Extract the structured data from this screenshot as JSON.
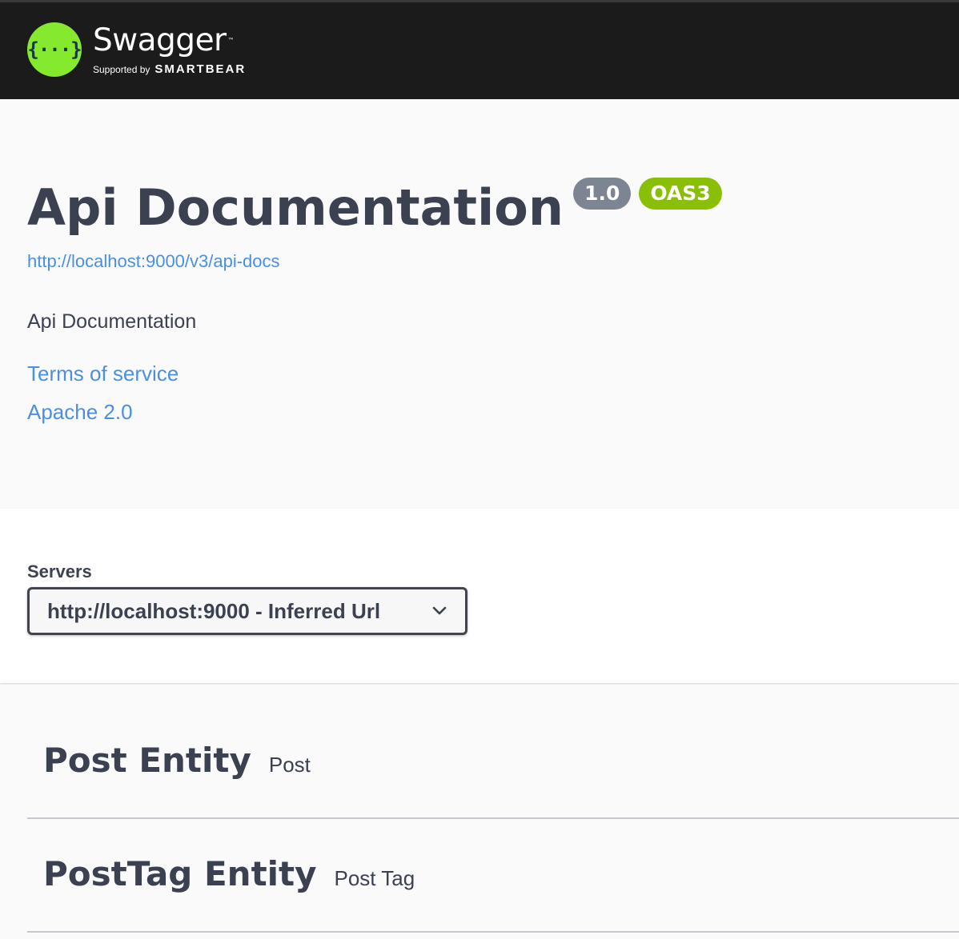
{
  "topbar": {
    "brand_name": "Swagger",
    "brand_tm": "™",
    "logo_glyph": "{···}",
    "supported_by": "Supported by",
    "sponsor": "SMARTBEAR",
    "logo_color": "#85ea2d",
    "background_color": "#1b1b1b"
  },
  "info": {
    "title": "Api Documentation",
    "version_badge": "1.0",
    "oas_badge": "OAS3",
    "spec_url": "http://localhost:9000/v3/api-docs",
    "description": "Api Documentation",
    "terms_link": "Terms of service",
    "license_link": "Apache 2.0",
    "version_badge_color": "#7d8492",
    "oas_badge_color": "#89bf04",
    "link_color": "#4990e2"
  },
  "servers": {
    "label": "Servers",
    "selected": "http://localhost:9000 - Inferred Url",
    "chevron_icon": "chevron-down-icon"
  },
  "tags": [
    {
      "name": "Post Entity",
      "description": "Post"
    },
    {
      "name": "PostTag Entity",
      "description": "Post Tag"
    }
  ]
}
